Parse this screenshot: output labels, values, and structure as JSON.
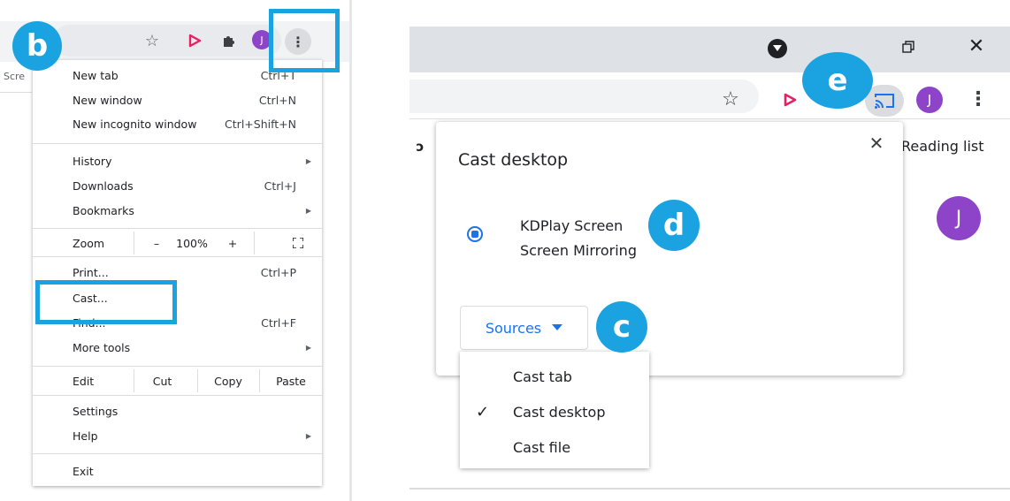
{
  "left": {
    "tab_label": "Scre",
    "avatar_letter": "J",
    "menu": {
      "new_tab": {
        "label": "New tab",
        "shortcut": "Ctrl+T"
      },
      "new_window": {
        "label": "New window",
        "shortcut": "Ctrl+N"
      },
      "new_incognito": {
        "label": "New incognito window",
        "shortcut": "Ctrl+Shift+N"
      },
      "history": {
        "label": "History"
      },
      "downloads": {
        "label": "Downloads",
        "shortcut": "Ctrl+J"
      },
      "bookmarks": {
        "label": "Bookmarks"
      },
      "zoom": {
        "label": "Zoom",
        "minus": "–",
        "value": "100%",
        "plus": "+"
      },
      "print": {
        "label": "Print...",
        "shortcut": "Ctrl+P"
      },
      "cast": {
        "label": "Cast..."
      },
      "find": {
        "label": "Find...",
        "shortcut": "Ctrl+F"
      },
      "more_tools": {
        "label": "More tools"
      },
      "edit": {
        "label": "Edit",
        "cut": "Cut",
        "copy": "Copy",
        "paste": "Paste"
      },
      "settings": {
        "label": "Settings"
      },
      "help": {
        "label": "Help"
      },
      "exit": {
        "label": "Exit"
      }
    }
  },
  "badges": {
    "b": "b",
    "c": "c",
    "d": "d",
    "e": "e"
  },
  "right": {
    "reading_list": "Reading list",
    "avatar_letter": "J",
    "cast_dialog": {
      "title": "Cast desktop",
      "sink_name": "KDPlay Screen",
      "sink_status": "Screen Mirroring",
      "sources_label": "Sources"
    },
    "sources_menu": [
      {
        "label": "Cast tab",
        "checked": false
      },
      {
        "label": "Cast desktop",
        "checked": true
      },
      {
        "label": "Cast file",
        "checked": false
      }
    ]
  },
  "colors": {
    "highlight": "#1aa3e0",
    "accent": "#1a73e8",
    "avatar": "#8e44c9"
  }
}
